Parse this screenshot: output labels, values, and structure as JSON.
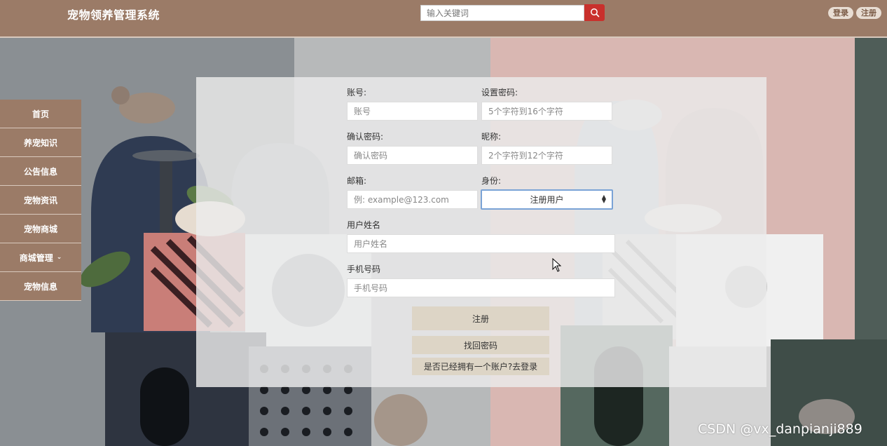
{
  "header": {
    "title": "宠物领养管理系统",
    "search_placeholder": "输入关键词",
    "login_label": "登录",
    "register_label": "注册"
  },
  "icons": {
    "search": "search-icon",
    "dropdown": "chevron-down-icon",
    "select": "select-arrows-icon"
  },
  "colors": {
    "header": "#9b7b67",
    "search_button": "#c9302c",
    "form_button": "#ddd5c6"
  },
  "sidebar": {
    "items": [
      {
        "label": "首页"
      },
      {
        "label": "养宠知识"
      },
      {
        "label": "公告信息"
      },
      {
        "label": "宠物资讯"
      },
      {
        "label": "宠物商城"
      },
      {
        "label": "商城管理"
      },
      {
        "label": "宠物信息"
      }
    ]
  },
  "form": {
    "account": {
      "label": "账号:",
      "placeholder": "账号"
    },
    "password": {
      "label": "设置密码:",
      "placeholder": "5个字符到16个字符"
    },
    "confirm": {
      "label": "确认密码:",
      "placeholder": "确认密码"
    },
    "nickname": {
      "label": "昵称:",
      "placeholder": "2个字符到12个字符"
    },
    "email": {
      "label": "邮箱:",
      "placeholder": "例: example@123.com"
    },
    "role": {
      "label": "身份:",
      "value": "注册用户"
    },
    "username": {
      "label": "用户姓名",
      "placeholder": "用户姓名"
    },
    "phone": {
      "label": "手机号码",
      "placeholder": "手机号码"
    },
    "register_button": "注册",
    "recover_button": "找回密码",
    "go_login_button": "是否已经拥有一个账户?去登录"
  },
  "watermark": "CSDN @vx_danpianji889"
}
